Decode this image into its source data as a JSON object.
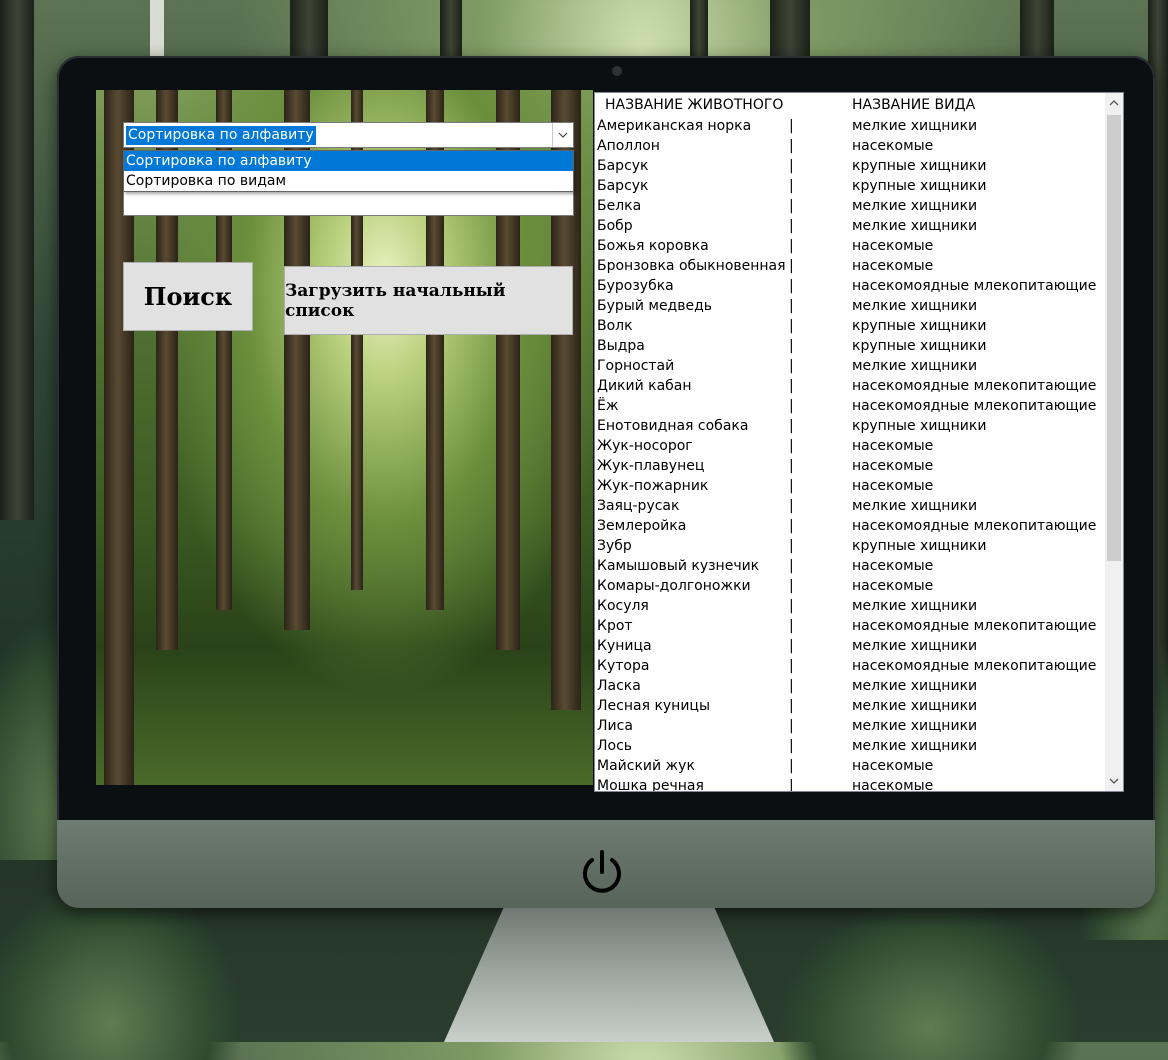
{
  "sort_combo": {
    "selected": "Сортировка по алфавиту",
    "options": [
      "Сортировка по алфавиту",
      "Сортировка по видам"
    ]
  },
  "search_input": {
    "value": ""
  },
  "buttons": {
    "search": "Поиск",
    "load": "Загрузить начальный список"
  },
  "list": {
    "headers": {
      "name": "НАЗВАНИЕ ЖИВОТНОГО",
      "type": "НАЗВАНИЕ ВИДА"
    },
    "separator": "|",
    "rows": [
      {
        "name": "Американская норка",
        "type": "мелкие хищники"
      },
      {
        "name": "Аполлон",
        "type": "насекомые"
      },
      {
        "name": "Барсук",
        "type": "крупные хищники"
      },
      {
        "name": "Барсук",
        "type": "крупные хищники"
      },
      {
        "name": "Белка",
        "type": "мелкие хищники"
      },
      {
        "name": "Бобр",
        "type": "мелкие хищники"
      },
      {
        "name": "Божья коровка",
        "type": "насекомые"
      },
      {
        "name": "Бронзовка обыкновенная",
        "type": "насекомые"
      },
      {
        "name": "Бурозубка",
        "type": "насекомоядные млекопитающие"
      },
      {
        "name": "Бурый медведь",
        "type": "мелкие хищники"
      },
      {
        "name": "Волк",
        "type": "крупные хищники"
      },
      {
        "name": "Выдра",
        "type": "крупные хищники"
      },
      {
        "name": "Горностай",
        "type": "мелкие хищники"
      },
      {
        "name": "Дикий кабан",
        "type": "насекомоядные млекопитающие"
      },
      {
        "name": "Ёж",
        "type": "насекомоядные млекопитающие"
      },
      {
        "name": "Енотовидная собака",
        "type": "крупные хищники"
      },
      {
        "name": "Жук-носорог",
        "type": "насекомые"
      },
      {
        "name": "Жук-плавунец",
        "type": "насекомые"
      },
      {
        "name": "Жук-пожарник",
        "type": "насекомые"
      },
      {
        "name": "Заяц-русак",
        "type": "мелкие хищники"
      },
      {
        "name": "Землеройка",
        "type": "насекомоядные млекопитающие"
      },
      {
        "name": "Зубр",
        "type": "крупные хищники"
      },
      {
        "name": "Камышовый кузнечик",
        "type": "насекомые"
      },
      {
        "name": "Комары-долгоножки",
        "type": "насекомые"
      },
      {
        "name": "Косуля",
        "type": "мелкие хищники"
      },
      {
        "name": "Крот",
        "type": "насекомоядные млекопитающие"
      },
      {
        "name": "Куница",
        "type": "мелкие хищники"
      },
      {
        "name": "Кутора",
        "type": "насекомоядные млекопитающие"
      },
      {
        "name": "Ласка",
        "type": "мелкие хищники"
      },
      {
        "name": "Лесная куницы",
        "type": "мелкие хищники"
      },
      {
        "name": "Лиса",
        "type": "мелкие хищники"
      },
      {
        "name": "Лось",
        "type": "мелкие хищники"
      },
      {
        "name": "Майский жук",
        "type": "насекомые"
      },
      {
        "name": "Мошка речная",
        "type": "насекомые"
      }
    ]
  },
  "icons": {
    "combo_arrow": "chevron-down-icon",
    "power": "power-icon",
    "scroll_up": "scroll-up-icon",
    "scroll_down": "scroll-down-icon"
  },
  "colors": {
    "selection": "#0078d7",
    "button_face": "#e1e1e1"
  }
}
